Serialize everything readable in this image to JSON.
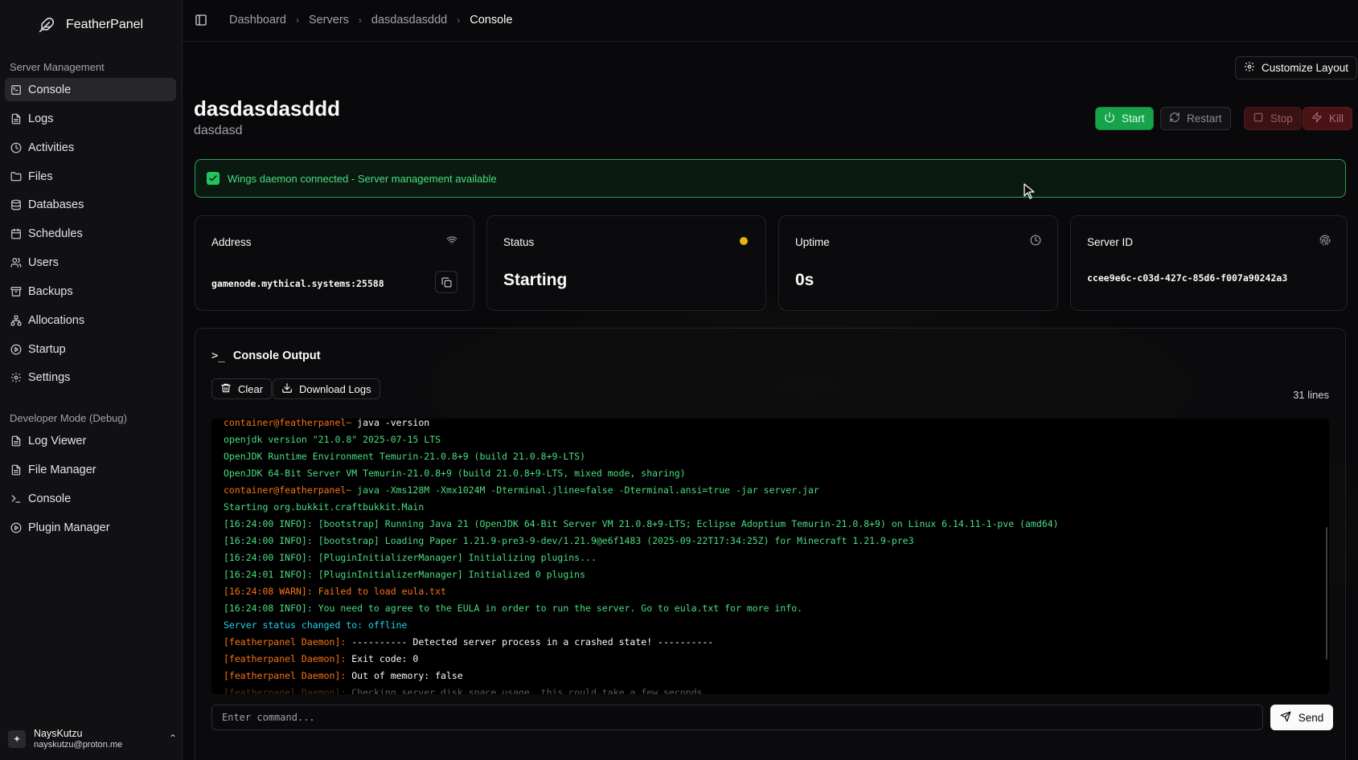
{
  "app": {
    "name": "FeatherPanel"
  },
  "sidebar": {
    "sections": [
      {
        "label": "Server Management",
        "items": [
          {
            "label": "Console",
            "icon": "terminal-square-icon",
            "active": true
          },
          {
            "label": "Logs",
            "icon": "file-text-icon"
          },
          {
            "label": "Activities",
            "icon": "clock-icon"
          },
          {
            "label": "Files",
            "icon": "folder-icon"
          },
          {
            "label": "Databases",
            "icon": "database-icon"
          },
          {
            "label": "Schedules",
            "icon": "calendar-icon"
          },
          {
            "label": "Users",
            "icon": "users-icon"
          },
          {
            "label": "Backups",
            "icon": "archive-icon"
          },
          {
            "label": "Allocations",
            "icon": "network-icon"
          },
          {
            "label": "Startup",
            "icon": "play-circle-icon"
          },
          {
            "label": "Settings",
            "icon": "gear-icon"
          }
        ]
      },
      {
        "label": "Developer Mode (Debug)",
        "items": [
          {
            "label": "Log Viewer",
            "icon": "file-text-icon"
          },
          {
            "label": "File Manager",
            "icon": "file-text-icon"
          },
          {
            "label": "Console",
            "icon": "terminal-icon"
          },
          {
            "label": "Plugin Manager",
            "icon": "play-circle-icon"
          }
        ]
      }
    ],
    "user": {
      "name": "NaysKutzu",
      "email": "nayskutzu@proton.me"
    }
  },
  "breadcrumb": [
    "Dashboard",
    "Servers",
    "dasdasdasddd",
    "Console"
  ],
  "header": {
    "customize_label": "Customize Layout",
    "server_name": "dasdasdasddd",
    "server_description": "dasdasd",
    "actions": {
      "start": "Start",
      "restart": "Restart",
      "stop": "Stop",
      "kill": "Kill"
    }
  },
  "alert": {
    "text": "Wings daemon connected - Server management available"
  },
  "cards": {
    "address": {
      "label": "Address",
      "value": "gamenode.mythical.systems:25588"
    },
    "status": {
      "label": "Status",
      "value": "Starting",
      "dot_color": "#eab308"
    },
    "uptime": {
      "label": "Uptime",
      "value": "0s"
    },
    "server_id": {
      "label": "Server ID",
      "value": "ccee9e6c-c03d-427c-85d6-f007a90242a3"
    }
  },
  "console": {
    "title": "Console Output",
    "clear_label": "Clear",
    "download_label": "Download Logs",
    "lines_count": "31 lines",
    "lines": [
      {
        "parts": [
          {
            "t": "container@featherpanel~ ",
            "c": "c-orange"
          },
          {
            "t": "java -version",
            "c": "c-white"
          }
        ]
      },
      {
        "parts": [
          {
            "t": "openjdk version \"21.0.8\" 2025-07-15 LTS",
            "c": "c-green"
          }
        ]
      },
      {
        "parts": [
          {
            "t": "OpenJDK Runtime Environment Temurin-21.0.8+9 (build 21.0.8+9-LTS)",
            "c": "c-green"
          }
        ]
      },
      {
        "parts": [
          {
            "t": "OpenJDK 64-Bit Server VM Temurin-21.0.8+9 (build 21.0.8+9-LTS, mixed mode, sharing)",
            "c": "c-green"
          }
        ]
      },
      {
        "parts": [
          {
            "t": "container@featherpanel~ ",
            "c": "c-orange"
          },
          {
            "t": "java -Xms128M -Xmx1024M -Dterminal.jline=false -Dterminal.ansi=true -jar server.jar",
            "c": "c-green"
          }
        ]
      },
      {
        "parts": [
          {
            "t": "Starting org.bukkit.craftbukkit.Main",
            "c": "c-green"
          }
        ]
      },
      {
        "parts": [
          {
            "t": "[16:24:00 INFO]: [bootstrap] Running Java 21 (OpenJDK 64-Bit Server VM 21.0.8+9-LTS; Eclipse Adoptium Temurin-21.0.8+9) on Linux 6.14.11-1-pve (amd64)",
            "c": "c-green"
          }
        ]
      },
      {
        "parts": [
          {
            "t": "[16:24:00 INFO]: [bootstrap] Loading Paper 1.21.9-pre3-9-dev/1.21.9@e6f1483 (2025-09-22T17:34:25Z) for Minecraft 1.21.9-pre3",
            "c": "c-green"
          }
        ]
      },
      {
        "parts": [
          {
            "t": "[16:24:00 INFO]: [PluginInitializerManager] Initializing plugins...",
            "c": "c-green"
          }
        ]
      },
      {
        "parts": [
          {
            "t": "[16:24:01 INFO]: [PluginInitializerManager] Initialized 0 plugins",
            "c": "c-green"
          }
        ]
      },
      {
        "parts": [
          {
            "t": "[16:24:08 WARN]: Failed to load eula.txt",
            "c": "c-orange"
          }
        ]
      },
      {
        "parts": [
          {
            "t": "[16:24:08 INFO]: You need to agree to the EULA in order to run the server. Go to eula.txt for more info.",
            "c": "c-green"
          }
        ]
      },
      {
        "parts": [
          {
            "t": "Server status changed to: offline",
            "c": "c-cyan"
          }
        ]
      },
      {
        "parts": [
          {
            "t": "[featherpanel Daemon]: ",
            "c": "c-orange"
          },
          {
            "t": "---------- Detected server process in a crashed state! ----------",
            "c": "c-white"
          }
        ]
      },
      {
        "parts": [
          {
            "t": "[featherpanel Daemon]: ",
            "c": "c-orange"
          },
          {
            "t": "Exit code: 0",
            "c": "c-white"
          }
        ]
      },
      {
        "parts": [
          {
            "t": "[featherpanel Daemon]: ",
            "c": "c-orange"
          },
          {
            "t": "Out of memory: false",
            "c": "c-white"
          }
        ]
      },
      {
        "parts": [
          {
            "t": "[featherpanel Daemon]: ",
            "c": "c-orange c-dim"
          },
          {
            "t": "Checking server disk space usage, this could take a few seconds...",
            "c": "c-white c-dim"
          }
        ]
      }
    ],
    "input_placeholder": "Enter command...",
    "send_label": "Send"
  }
}
